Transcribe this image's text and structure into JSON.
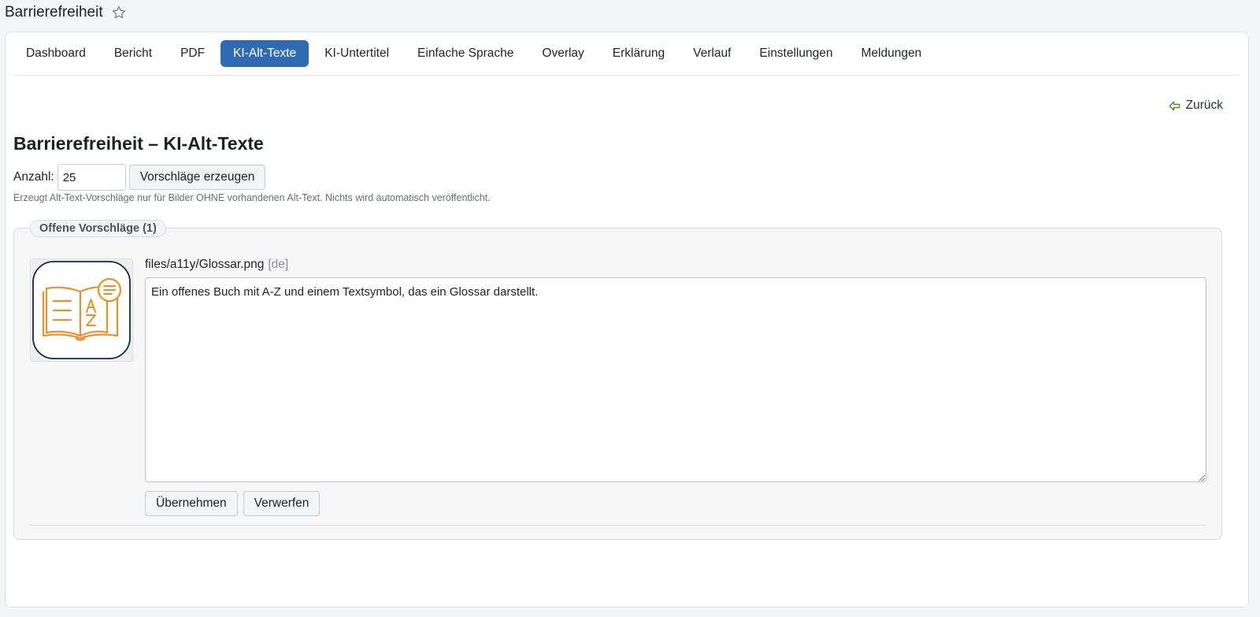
{
  "page": {
    "title": "Barrierefreiheit"
  },
  "tabs": [
    {
      "label": "Dashboard",
      "active": false
    },
    {
      "label": "Bericht",
      "active": false
    },
    {
      "label": "PDF",
      "active": false
    },
    {
      "label": "KI-Alt-Texte",
      "active": true
    },
    {
      "label": "KI-Untertitel",
      "active": false
    },
    {
      "label": "Einfache Sprache",
      "active": false
    },
    {
      "label": "Overlay",
      "active": false
    },
    {
      "label": "Erklärung",
      "active": false
    },
    {
      "label": "Verlauf",
      "active": false
    },
    {
      "label": "Einstellungen",
      "active": false
    },
    {
      "label": "Meldungen",
      "active": false
    }
  ],
  "back": {
    "label": "Zurück"
  },
  "heading": "Barrierefreiheit – KI-Alt-Texte",
  "form": {
    "count_label": "Anzahl:",
    "count_value": "25",
    "generate_button": "Vorschläge erzeugen",
    "hint": "Erzeugt Alt-Text-Vorschläge nur für Bilder OHNE vorhandenen Alt-Text. Nichts wird automatisch veröffentlicht."
  },
  "suggestions": {
    "legend": "Offene Vorschläge (1)",
    "items": [
      {
        "filename": "files/a11y/Glossar.png",
        "lang": "[de]",
        "alt_text": "Ein offenes Buch mit A-Z und einem Textsymbol, das ein Glossar darstellt.",
        "accept_label": "Übernehmen",
        "discard_label": "Verwerfen"
      }
    ]
  },
  "colors": {
    "accent": "#2f6bb3",
    "icon_orange": "#e8902e",
    "icon_border": "#0f2a45",
    "back_arrow": "#4f8a1f"
  },
  "icons": {
    "favorite": "star-outline-icon",
    "back": "arrow-left-icon"
  }
}
